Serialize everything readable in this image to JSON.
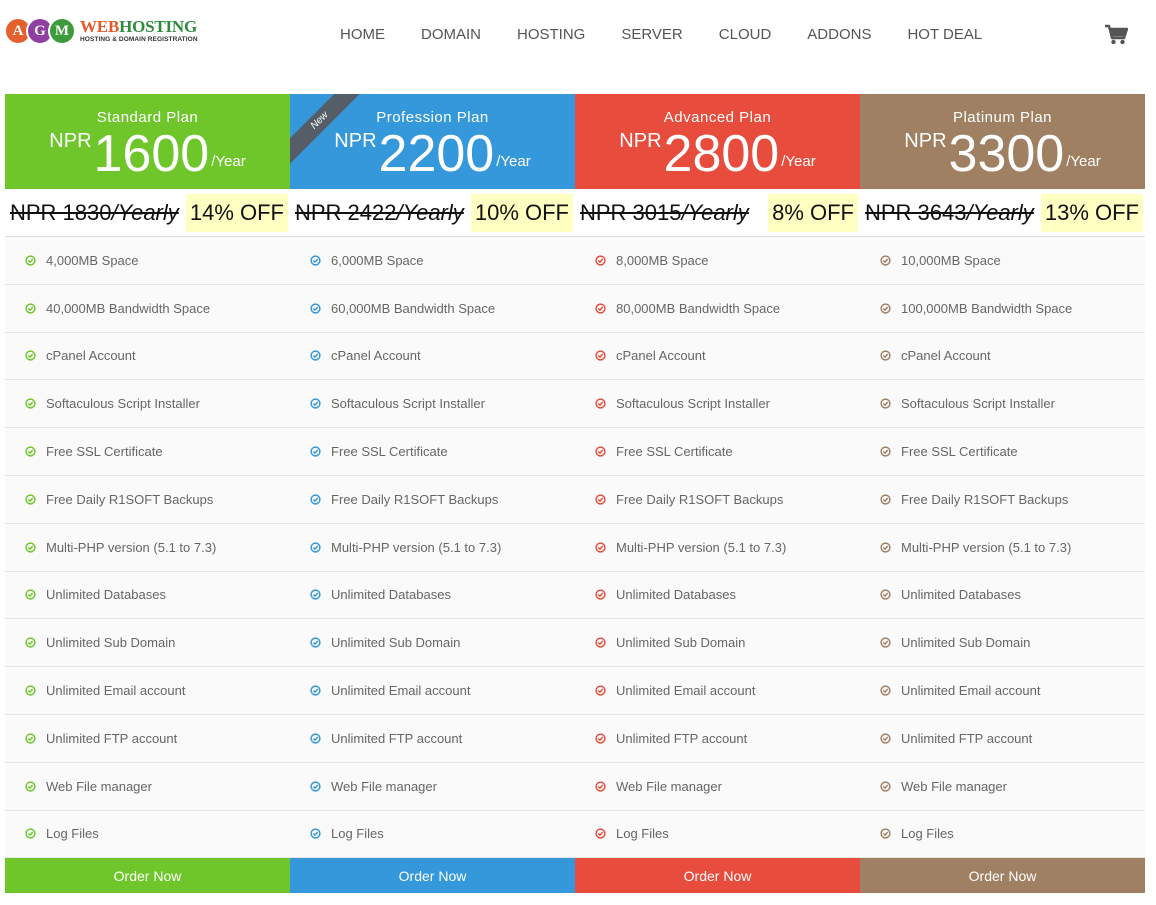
{
  "logo": {
    "letters": [
      "A",
      "G",
      "M"
    ],
    "letter_colors": [
      "#e4602c",
      "#8e3fa0",
      "#3c9b3a"
    ],
    "brand_prefix": "WEB",
    "brand_rest": "HOSTING",
    "tagline": "HOSTING & DOMAIN REGISTRATION"
  },
  "nav": [
    "HOME",
    "DOMAIN",
    "HOSTING",
    "SERVER",
    "CLOUD",
    "ADDONS",
    "HOT DEAL"
  ],
  "cart_icon": "shopping-cart-icon",
  "plans": [
    {
      "name": "Standard Plan",
      "currency": "NPR",
      "price": "1600",
      "per": "/Year",
      "old_price": "NPR 1830",
      "old_suffix": "/Yearly",
      "discount": "14% OFF",
      "color": "#6ec62b",
      "order_label": "Order Now"
    },
    {
      "name": "Profession Plan",
      "currency": "NPR",
      "price": "2200",
      "per": "/Year",
      "old_price": "NPR 2422",
      "old_suffix": "/Yearly",
      "discount": "10% OFF",
      "color": "#3498db",
      "ribbon": "New",
      "order_label": "Order Now"
    },
    {
      "name": "Advanced Plan",
      "currency": "NPR",
      "price": "2800",
      "per": "/Year",
      "old_price": "NPR 3015",
      "old_suffix": "/Yearly",
      "discount": "8% OFF",
      "color": "#e74c3c",
      "order_label": "Order Now"
    },
    {
      "name": "Platinum Plan",
      "currency": "NPR",
      "price": "3300",
      "per": "/Year",
      "old_price": "NPR 3643",
      "old_suffix": "/Yearly",
      "discount": "13% OFF",
      "color": "#a08062",
      "order_label": "Order Now"
    }
  ],
  "features": [
    [
      "4,000MB Space",
      "6,000MB Space",
      "8,000MB Space",
      "10,000MB Space"
    ],
    [
      "40,000MB Bandwidth Space",
      "60,000MB Bandwidth Space",
      "80,000MB Bandwidth Space",
      "100,000MB Bandwidth Space"
    ],
    [
      "cPanel Account",
      "cPanel Account",
      "cPanel Account",
      "cPanel Account"
    ],
    [
      "Softaculous Script Installer",
      "Softaculous Script Installer",
      "Softaculous Script Installer",
      "Softaculous Script Installer"
    ],
    [
      "Free SSL Certificate",
      "Free SSL Certificate",
      "Free SSL Certificate",
      "Free SSL Certificate"
    ],
    [
      "Free Daily R1SOFT Backups",
      "Free Daily R1SOFT Backups",
      "Free Daily R1SOFT Backups",
      "Free Daily R1SOFT Backups"
    ],
    [
      "Multi-PHP version (5.1 to 7.3)",
      "Multi-PHP version (5.1 to 7.3)",
      "Multi-PHP version (5.1 to 7.3)",
      "Multi-PHP version (5.1 to 7.3)"
    ],
    [
      "Unlimited Databases",
      "Unlimited Databases",
      "Unlimited Databases",
      "Unlimited Databases"
    ],
    [
      "Unlimited Sub Domain",
      "Unlimited Sub Domain",
      "Unlimited Sub Domain",
      "Unlimited Sub Domain"
    ],
    [
      "Unlimited Email account",
      "Unlimited Email account",
      "Unlimited Email account",
      "Unlimited Email account"
    ],
    [
      "Unlimited FTP account",
      "Unlimited FTP account",
      "Unlimited FTP account",
      "Unlimited FTP account"
    ],
    [
      "Web File manager",
      "Web File manager",
      "Web File manager",
      "Web File manager"
    ],
    [
      "Log Files",
      "Log Files",
      "Log Files",
      "Log Files"
    ]
  ],
  "feature_icon": "check-circle-icon"
}
